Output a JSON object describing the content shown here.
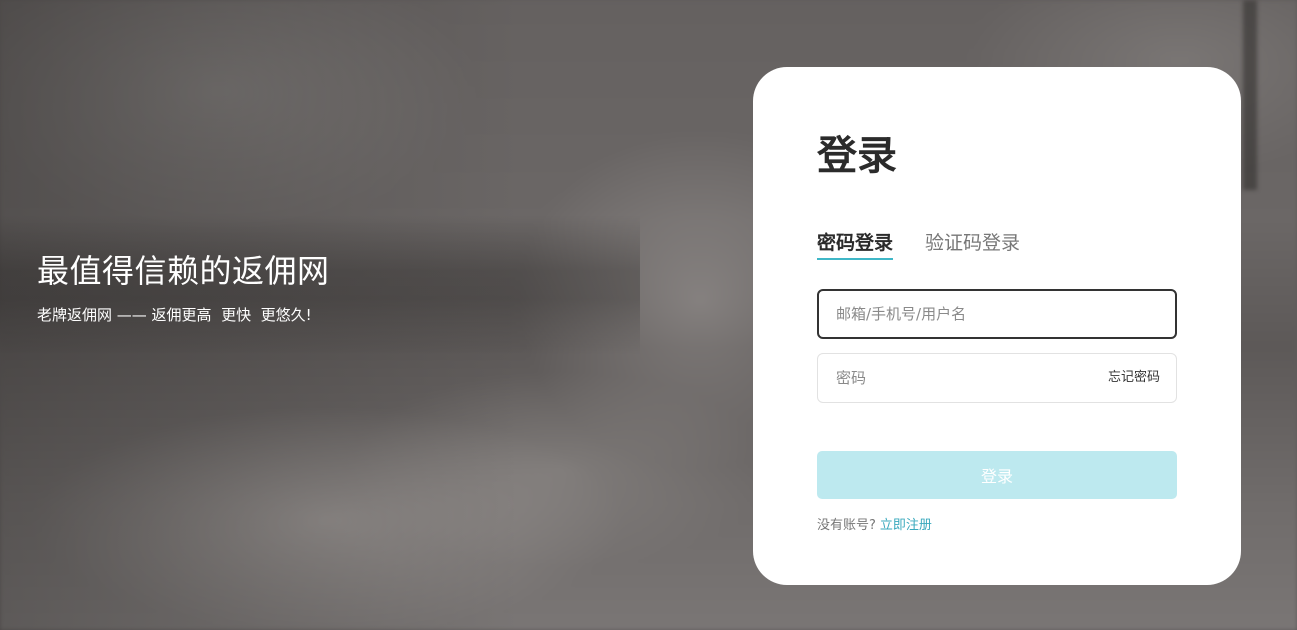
{
  "hero": {
    "title": "最值得信赖的返佣网",
    "subtitle": "老牌返佣网 —— 返佣更高  更快  更悠久!"
  },
  "login": {
    "title": "登录",
    "tabs": [
      {
        "label": "密码登录",
        "active": true
      },
      {
        "label": "验证码登录",
        "active": false
      }
    ],
    "account_field": {
      "placeholder": "邮箱/手机号/用户名",
      "value": ""
    },
    "password_field": {
      "placeholder": "密码",
      "value": ""
    },
    "forgot_label": "忘记密码",
    "submit_label": "登录",
    "register_prompt": "没有账号?",
    "register_link": "立即注册"
  },
  "colors": {
    "accent": "#3fb7c7",
    "button_bg": "#bde9ef",
    "link": "#3aa9bd",
    "card_bg": "#ffffff"
  }
}
